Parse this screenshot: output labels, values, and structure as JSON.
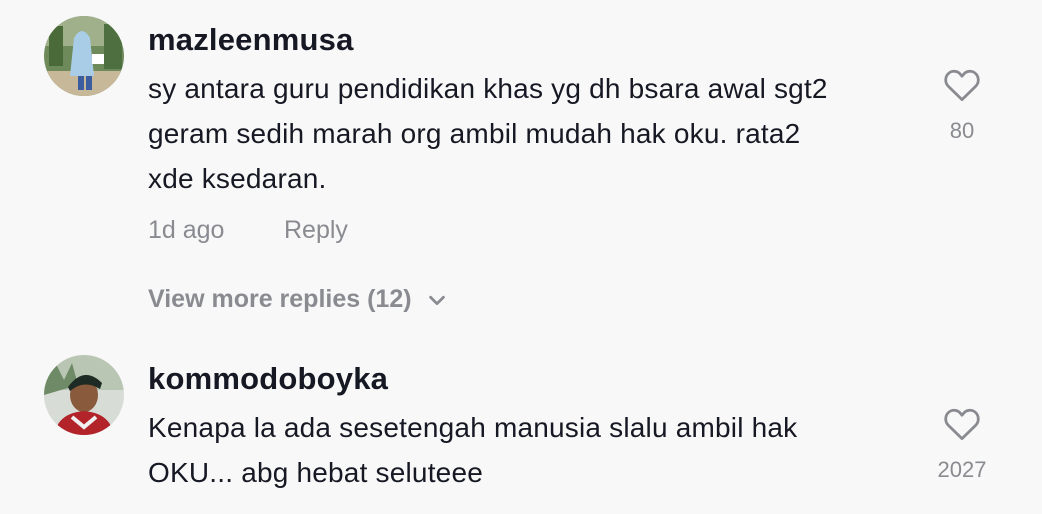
{
  "comments": [
    {
      "username": "mazleenmusa",
      "text_lines": [
        "sy antara guru pendidikan khas yg dh bsara awal sgt2",
        "geram sedih marah org ambil mudah hak oku. rata2",
        "xde ksedaran."
      ],
      "time": "1d ago",
      "reply_label": "Reply",
      "likes": "80",
      "view_more_label": "View more replies (12)"
    },
    {
      "username": "kommodoboyka",
      "text_lines": [
        "Kenapa la ada sesetengah manusia slalu ambil hak",
        "OKU... abg hebat seluteee"
      ],
      "likes": "2027"
    }
  ],
  "icons": {
    "like": "heart-icon",
    "expand": "chevron-down-icon"
  },
  "colors": {
    "background": "#f8f8f8",
    "primary_text": "#161823",
    "secondary_text": "#8a8b91"
  }
}
